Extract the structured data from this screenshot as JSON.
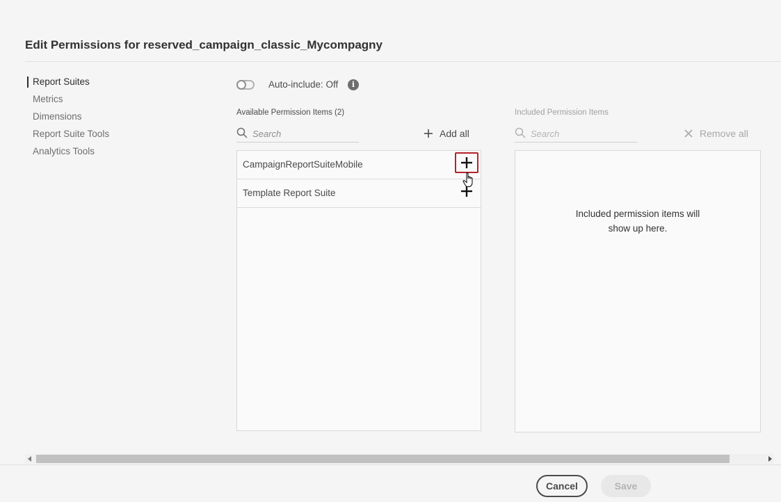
{
  "dialog": {
    "title": "Edit Permissions for reserved_campaign_classic_Mycompagny"
  },
  "nav": {
    "items": [
      {
        "label": "Report Suites",
        "active": true
      },
      {
        "label": "Metrics"
      },
      {
        "label": "Dimensions"
      },
      {
        "label": "Report Suite Tools"
      },
      {
        "label": "Analytics Tools"
      }
    ]
  },
  "auto_include": {
    "label": "Auto-include: Off",
    "state": "off"
  },
  "available": {
    "header": "Available Permission Items (2)",
    "search_placeholder": "Search",
    "add_all_label": "Add all",
    "items": [
      {
        "label": "CampaignReportSuiteMobile"
      },
      {
        "label": "Template Report Suite"
      }
    ]
  },
  "included": {
    "header": "Included Permission Items",
    "search_placeholder": "Search",
    "remove_all_label": "Remove all",
    "empty_line1": "Included permission items will",
    "empty_line2": "show up here."
  },
  "footer": {
    "cancel_label": "Cancel",
    "save_label": "Save"
  },
  "colors": {
    "focus_ring": "#b5232b",
    "background": "#f5f5f5"
  }
}
